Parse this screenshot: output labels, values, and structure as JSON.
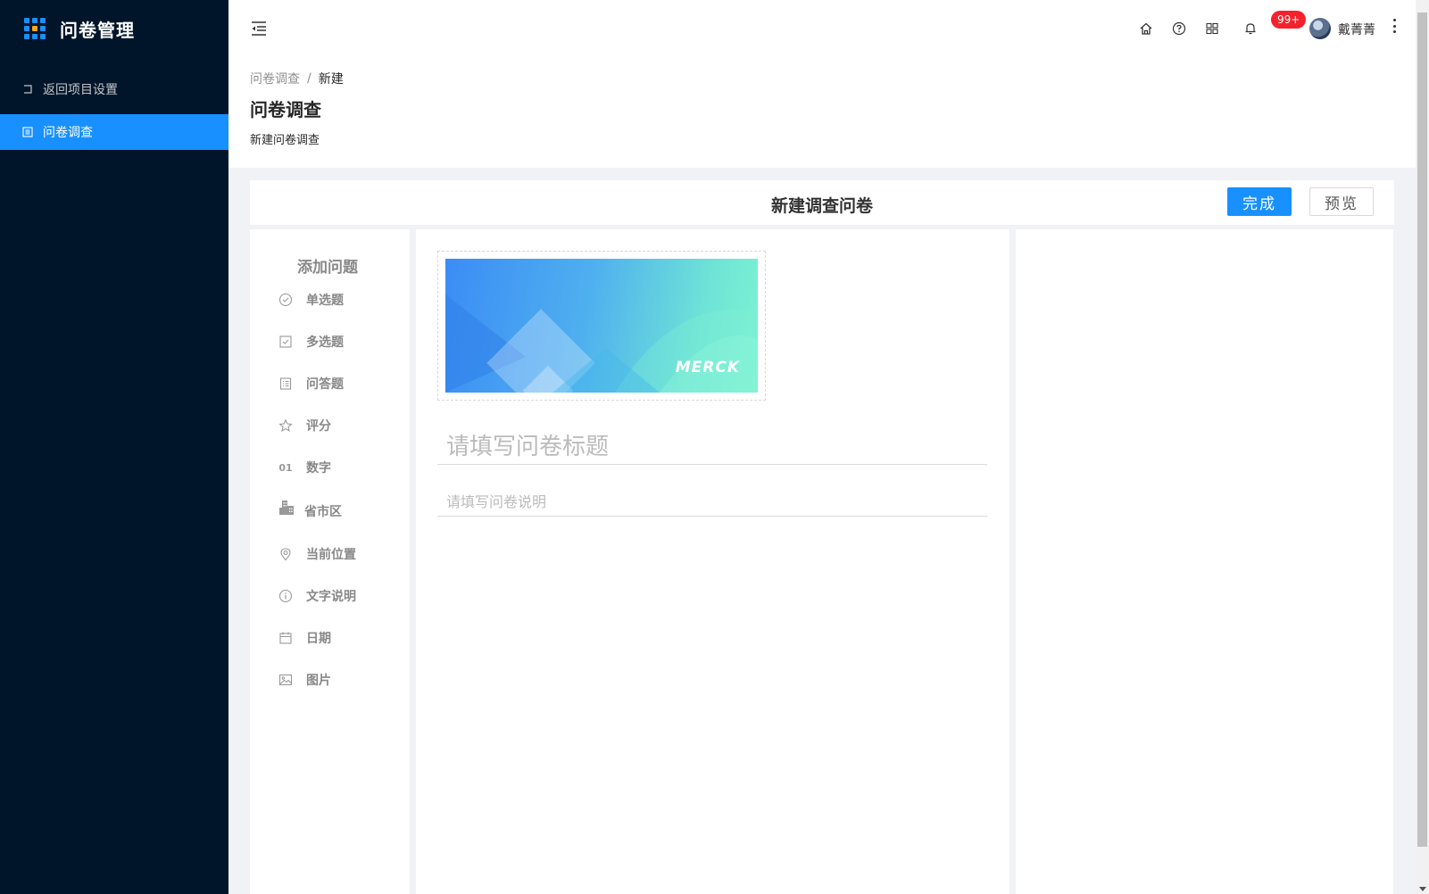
{
  "app": {
    "title": "问卷管理"
  },
  "sidebar": {
    "items": [
      {
        "label": "返回项目设置",
        "icon": "return-icon",
        "active": false
      },
      {
        "label": "问卷调查",
        "icon": "list-icon",
        "active": true
      }
    ]
  },
  "header": {
    "notification_count": "99+",
    "username": "戴菁菁"
  },
  "breadcrumb": {
    "parent": "问卷调查",
    "separator": "/",
    "current": "新建"
  },
  "page": {
    "title": "问卷调查",
    "subtitle": "新建问卷调查"
  },
  "editor": {
    "title": "新建调查问卷",
    "finish_label": "完成",
    "preview_label": "预览"
  },
  "palette": {
    "title": "添加问题",
    "items": [
      {
        "label": "单选题",
        "icon": "radio-check-icon"
      },
      {
        "label": "多选题",
        "icon": "checkbox-icon"
      },
      {
        "label": "问答题",
        "icon": "text-doc-icon"
      },
      {
        "label": "评分",
        "icon": "star-icon"
      },
      {
        "label": "数字",
        "icon": "number-icon",
        "glyph": "01"
      },
      {
        "label": "省市区",
        "icon": "city-icon"
      },
      {
        "label": "当前位置",
        "icon": "location-icon"
      },
      {
        "label": "文字说明",
        "icon": "info-icon"
      },
      {
        "label": "日期",
        "icon": "calendar-icon"
      },
      {
        "label": "图片",
        "icon": "image-icon"
      }
    ]
  },
  "survey": {
    "banner_brand": "MERCK",
    "title_placeholder": "请填写问卷标题",
    "desc_placeholder": "请填写问卷说明"
  },
  "colors": {
    "sidebar_bg": "#001529",
    "primary": "#1890ff",
    "badge": "#f5222d"
  }
}
